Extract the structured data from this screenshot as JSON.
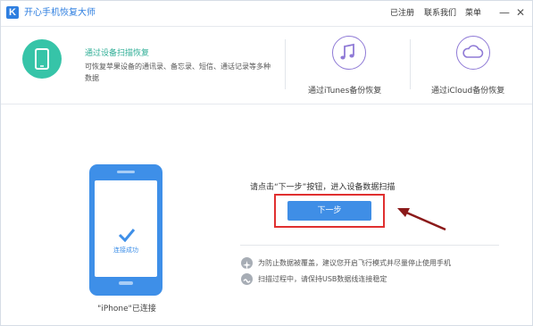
{
  "app": {
    "logo_letter": "K",
    "title": "开心手机恢复大师"
  },
  "titlebar": {
    "registered": "已注册",
    "contact": "联系我们",
    "menu": "菜单",
    "minimize": "—",
    "close": "✕"
  },
  "modes": {
    "device": {
      "title": "通过设备扫描恢复",
      "description": "可恢复苹果设备的通讯录、备忘录、短信、通话记录等多种数据",
      "icon": "phone-icon",
      "color": "#36c4a8"
    },
    "itunes": {
      "label": "通过iTunes备份恢复",
      "icon": "music-note-icon"
    },
    "icloud": {
      "label": "通过iCloud备份恢复",
      "icon": "cloud-icon"
    },
    "accent_color": "#8f7ad6"
  },
  "main": {
    "phone_status": "连接成功",
    "phone_caption": "\"iPhone\"已连接",
    "instruction": "请点击“下一步”按钮，进入设备数据扫描",
    "next_button": "下一步",
    "tips": [
      "为防止数据被覆盖，建议您开启飞行模式并尽量停止使用手机",
      "扫描过程中，请保持USB数据线连接稳定"
    ]
  },
  "colors": {
    "primary": "#3f8ee6",
    "highlight": "#e03030",
    "arrow": "#8b1a1a"
  }
}
